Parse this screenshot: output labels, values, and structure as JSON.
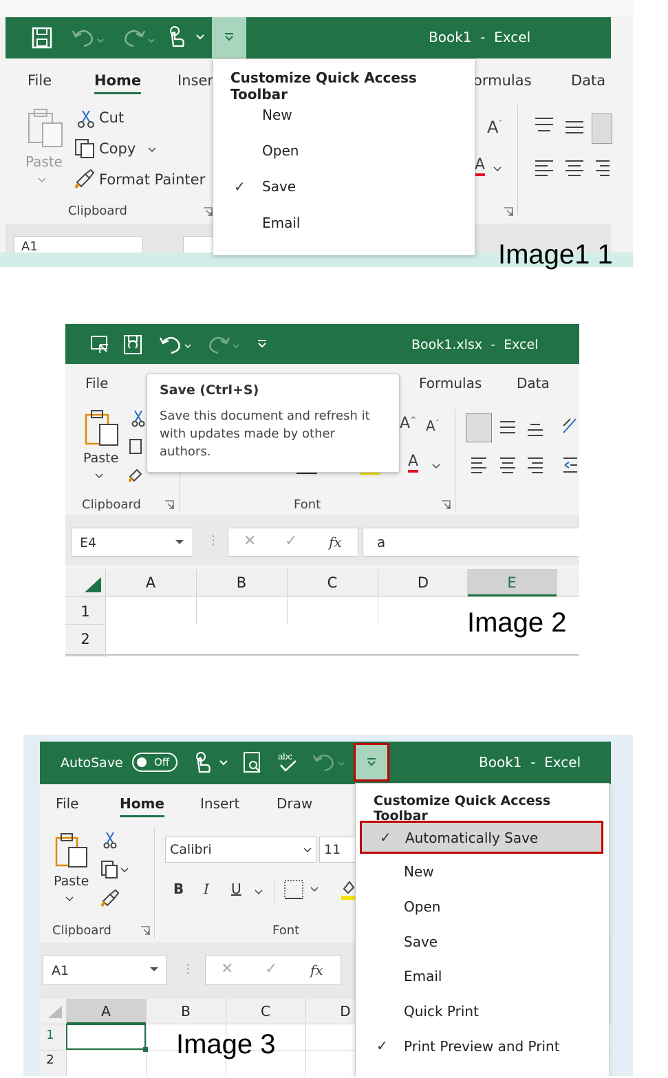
{
  "image1": {
    "title": "Book1  -  Excel",
    "tabs": [
      "File",
      "Home",
      "Inser",
      "ormulas",
      "Data"
    ],
    "clipboard": {
      "paste": "Paste",
      "cut": "Cut",
      "copy": "Copy",
      "format_painter": "Format Painter",
      "group": "Clipboard"
    },
    "name_box": "A1",
    "menu": {
      "title": "Customize Quick Access Toolbar",
      "items": [
        {
          "label": "New",
          "checked": false
        },
        {
          "label": "Open",
          "checked": false
        },
        {
          "label": "Save",
          "checked": true
        },
        {
          "label": "Email",
          "checked": false
        }
      ]
    },
    "caption": "Image1 1"
  },
  "image2": {
    "title": "Book1.xlsx  -  Excel",
    "tabs": [
      "File",
      "Formulas",
      "Data"
    ],
    "tooltip": {
      "title": "Save (Ctrl+S)",
      "body": "Save this document and refresh it with updates made by other authors."
    },
    "paste": "Paste",
    "groups": {
      "clipboard": "Clipboard",
      "font": "Font"
    },
    "name_box": "E4",
    "formula_value": "a",
    "fx": "fx",
    "columns": [
      "A",
      "B",
      "C",
      "D",
      "E"
    ],
    "rows": [
      "1",
      "2"
    ],
    "caption": "Image 2"
  },
  "image3": {
    "autosave_label": "AutoSave",
    "autosave_state": "Off",
    "title": "Book1  -  Excel",
    "tabs": [
      "File",
      "Home",
      "Insert",
      "Draw"
    ],
    "font_name": "Calibri",
    "font_size": "11",
    "format_buttons": [
      "B",
      "I",
      "U"
    ],
    "paste": "Paste",
    "groups": {
      "clipboard": "Clipboard",
      "font": "Font"
    },
    "name_box": "A1",
    "fx": "fx",
    "columns": [
      "A",
      "B",
      "C",
      "D"
    ],
    "rows": [
      "1",
      "2"
    ],
    "menu": {
      "title": "Customize Quick Access Toolbar",
      "items": [
        {
          "label": "Automatically Save",
          "checked": true
        },
        {
          "label": "New",
          "checked": false
        },
        {
          "label": "Open",
          "checked": false
        },
        {
          "label": "Save",
          "checked": false
        },
        {
          "label": "Email",
          "checked": false
        },
        {
          "label": "Quick Print",
          "checked": false
        },
        {
          "label": "Print Preview and Print",
          "checked": true
        }
      ]
    },
    "caption": "Image 3",
    "highlight_color": "#c00000"
  },
  "colors": {
    "excel_green": "#217346",
    "ribbon": "#f3f3f3"
  }
}
